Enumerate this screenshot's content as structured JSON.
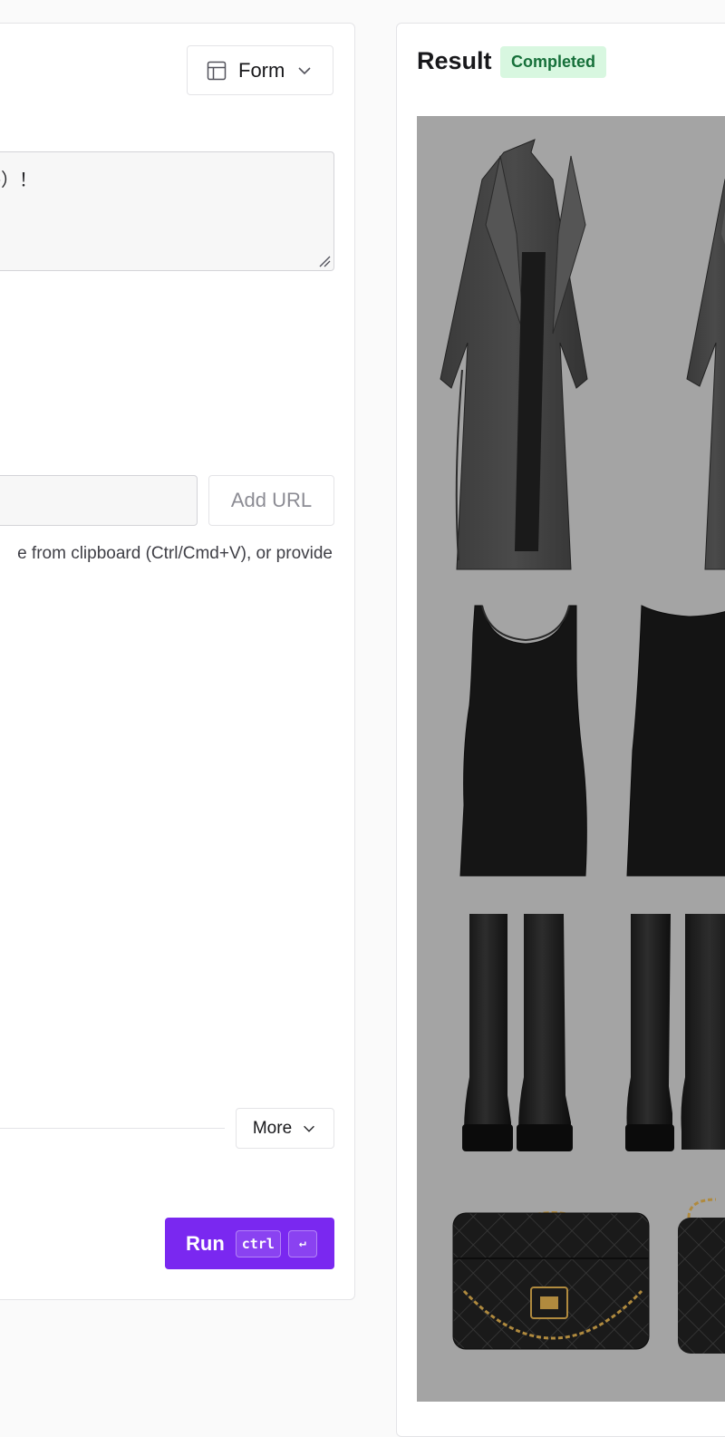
{
  "form_panel": {
    "view_select": {
      "label": "Form",
      "icon": "layout-icon",
      "chevron": "chevron-down-icon"
    },
    "prompt_textarea": {
      "value_visible": "风格）！"
    },
    "image_url": {
      "value": "",
      "add_label": "Add URL"
    },
    "hint_text": "e from clipboard (Ctrl/Cmd+V), or provide",
    "more_button": {
      "label": "More",
      "icon": "chevron-down-icon"
    },
    "run_button": {
      "label": "Run",
      "shortcut_key": "ctrl",
      "enter_key": "↵"
    }
  },
  "result_panel": {
    "title": "Result",
    "status": "Completed",
    "status_colors": {
      "background": "#d8f7e0",
      "text": "#16703a"
    },
    "image": {
      "items": [
        "coat",
        "dress",
        "boots",
        "handbag"
      ],
      "background": "#a4a4a4"
    }
  },
  "colors": {
    "accent": "#7a28f0",
    "border": "#e4e4e7",
    "page_background": "#fafafa"
  }
}
